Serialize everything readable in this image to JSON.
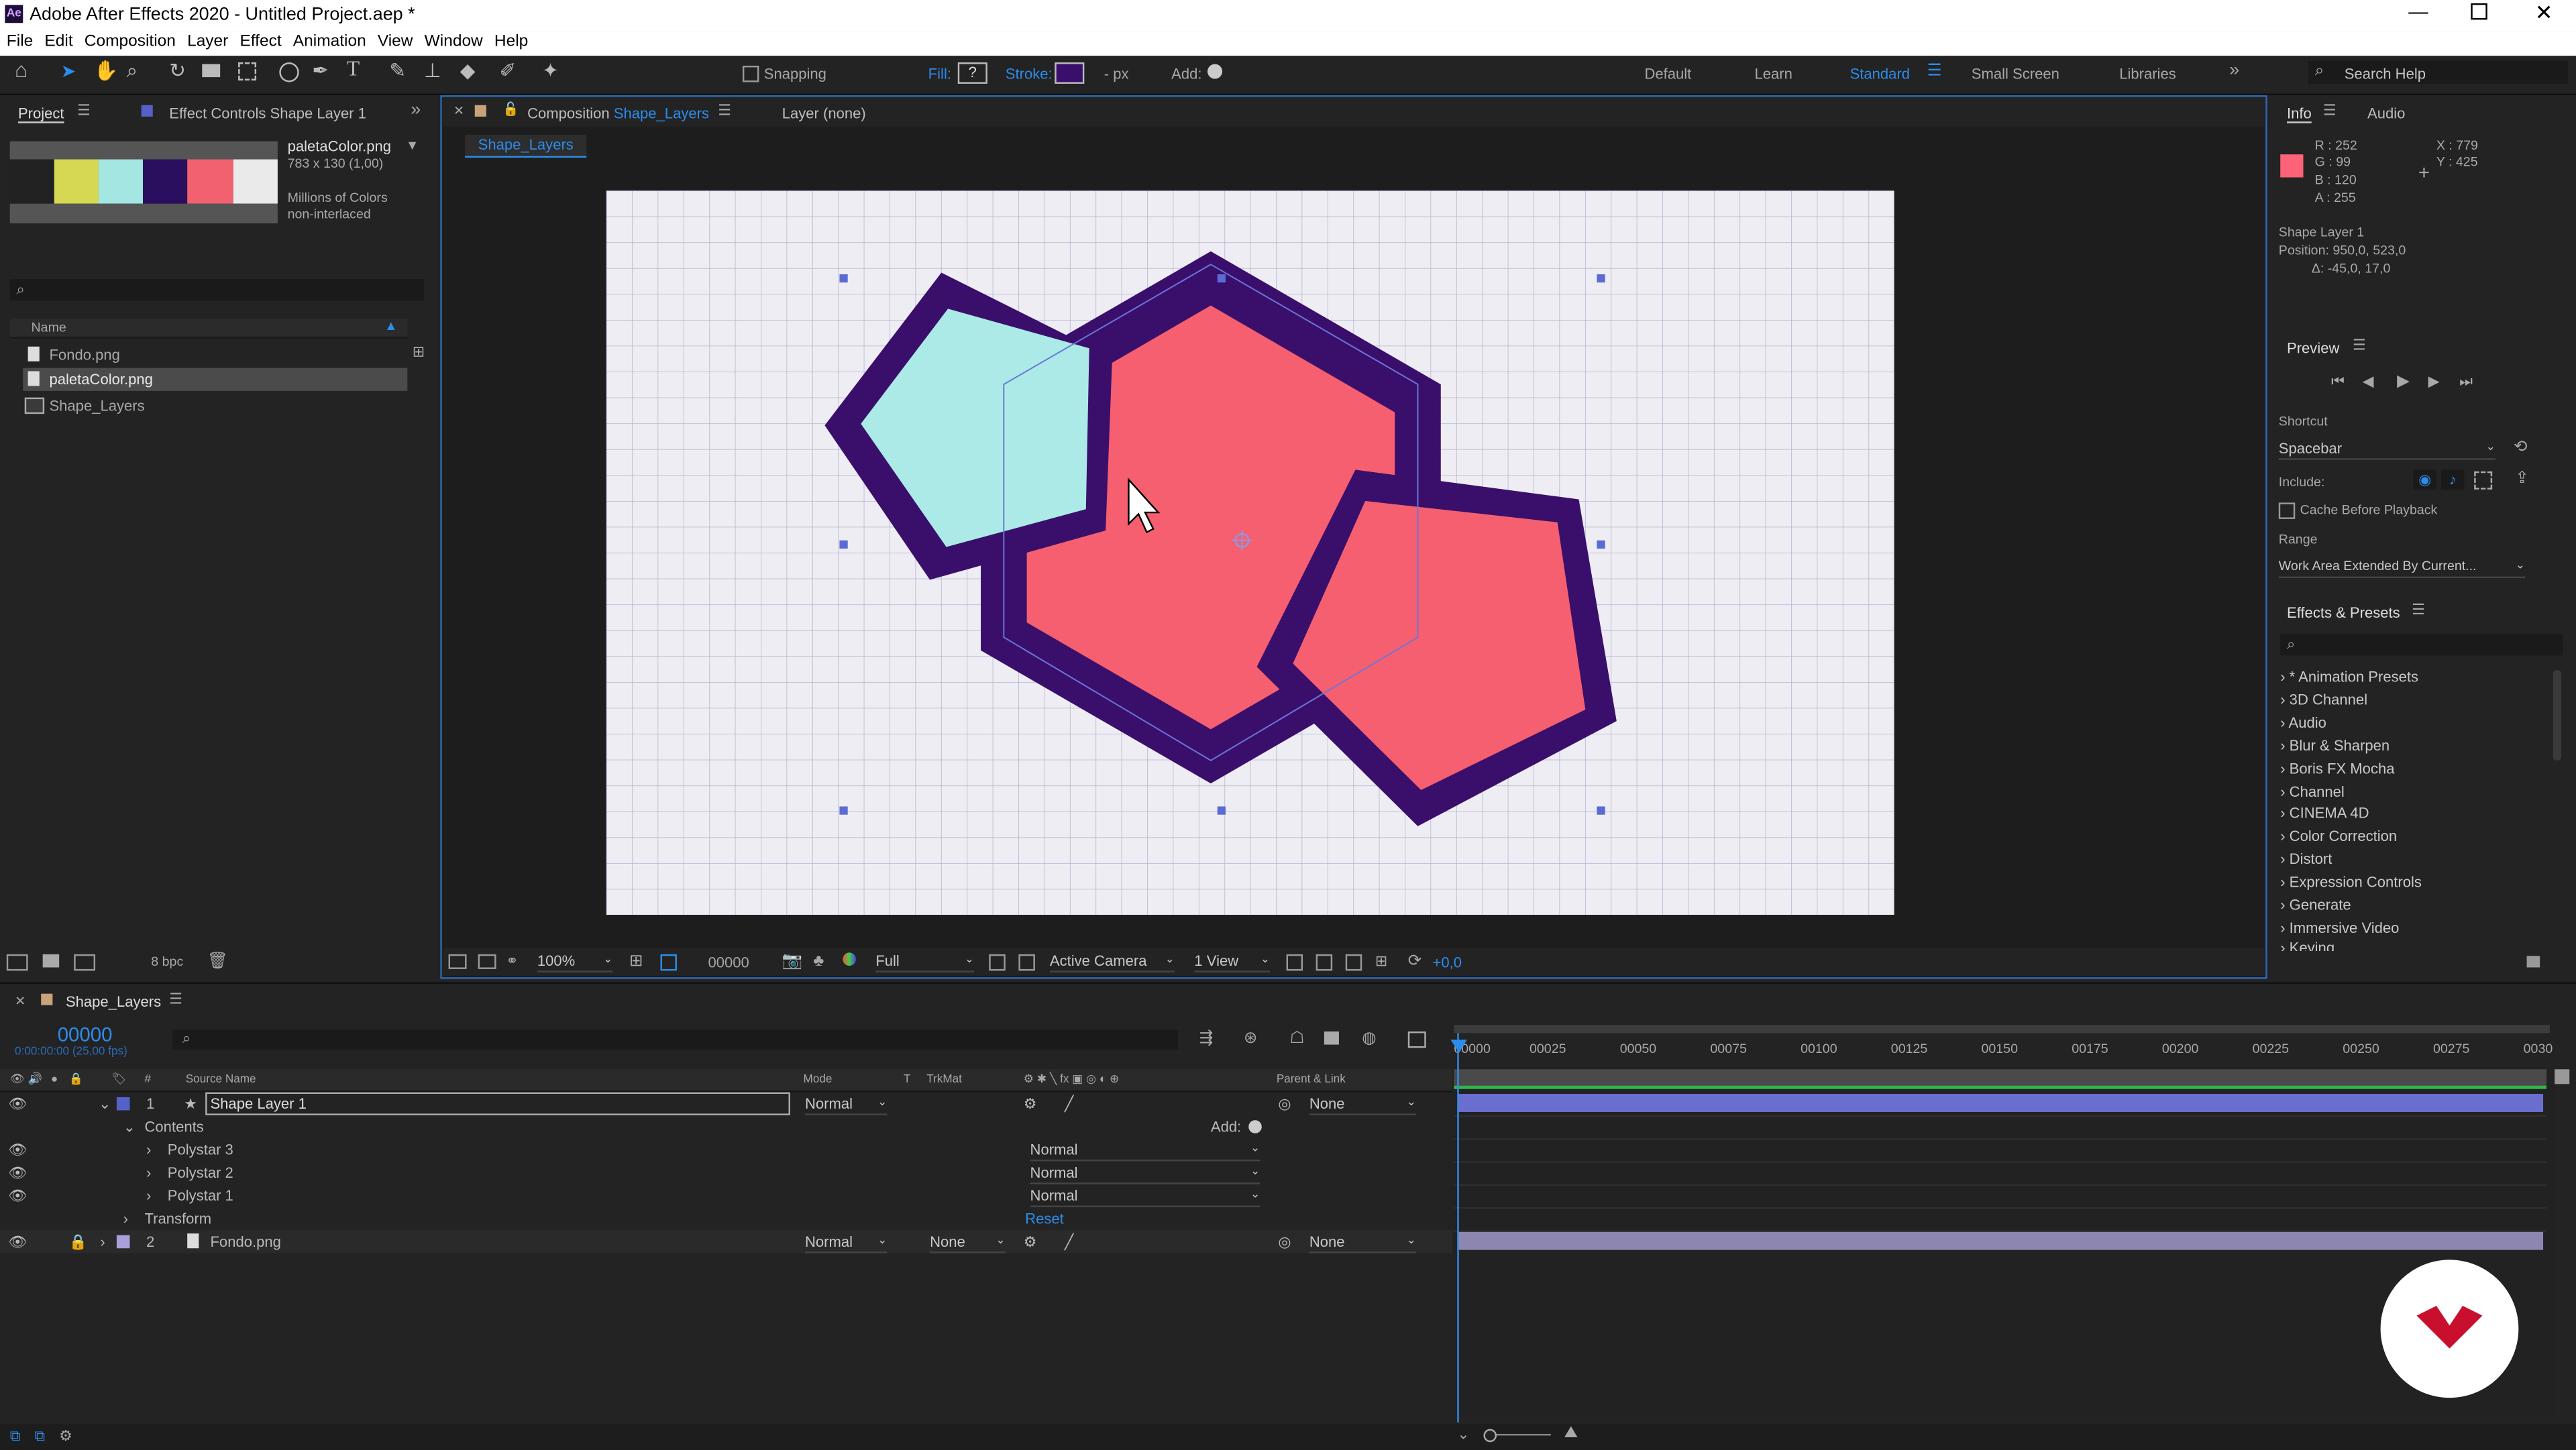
{
  "app": {
    "title": "Adobe After Effects 2020 - Untitled Project.aep *",
    "menu": [
      "File",
      "Edit",
      "Composition",
      "Layer",
      "Effect",
      "Animation",
      "View",
      "Window",
      "Help"
    ]
  },
  "toolbar": {
    "snapping": "Snapping",
    "fill_label": "Fill:",
    "fill_value": "?",
    "stroke_label": "Stroke:",
    "stroke_unit": "- px",
    "add_label": "Add:",
    "workspaces": [
      "Default",
      "Learn",
      "Standard",
      "Small Screen",
      "Libraries"
    ],
    "active_workspace": "Standard",
    "search_placeholder": "Search Help"
  },
  "project": {
    "tab_project": "Project",
    "tab_effect": "Effect Controls Shape Layer 1",
    "thumb_name": "paletaColor.png",
    "thumb_size": "783 x 130 (1,00)",
    "thumb_colors": "Millions of Colors",
    "thumb_interlace": "non-interlaced",
    "column_name": "Name",
    "items": [
      "Fondo.png",
      "paletaColor.png",
      "Shape_Layers"
    ],
    "bpc": "8 bpc",
    "palette": [
      "#222222",
      "#d6d854",
      "#a4e6e2",
      "#2a0f5e",
      "#f26170",
      "#eaeaea"
    ]
  },
  "composition": {
    "tab_prefix": "Composition",
    "tab_name": "Shape_Layers",
    "layer_tab": "Layer (none)",
    "sub_tab": "Shape_Layers",
    "zoom": "100%",
    "timecode": "00000",
    "resolution": "Full",
    "camera": "Active Camera",
    "views": "1 View",
    "exposure": "+0,0"
  },
  "info": {
    "tab_info": "Info",
    "tab_audio": "Audio",
    "r": "R : 252",
    "g": "G : 99",
    "b": "B : 120",
    "a": "A : 255",
    "x": "X : 779",
    "y": "Y : 425",
    "layer": "Shape Layer 1",
    "position": "Position: 950,0, 523,0",
    "delta": "Δ: -45,0, 17,0",
    "sample_color": "#fc6378"
  },
  "preview": {
    "title": "Preview",
    "shortcut_label": "Shortcut",
    "shortcut_value": "Spacebar",
    "include_label": "Include:",
    "cache": "Cache Before Playback",
    "range_label": "Range",
    "range_value": "Work Area Extended By Current..."
  },
  "effects": {
    "title": "Effects & Presets",
    "items": [
      "* Animation Presets",
      "3D Channel",
      "Audio",
      "Blur & Sharpen",
      "Boris FX Mocha",
      "Channel",
      "CINEMA 4D",
      "Color Correction",
      "Distort",
      "Expression Controls",
      "Generate",
      "Immersive Video",
      "Keying"
    ]
  },
  "timeline": {
    "tab": "Shape_Layers",
    "timecode": "00000",
    "timecode_sub": "0:00:00:00 (25,00 fps)",
    "headers": {
      "source": "Source Name",
      "mode": "Mode",
      "t": "T",
      "trkmat": "TrkMat",
      "parent": "Parent & Link"
    },
    "ruler": [
      "00000",
      "00025",
      "00050",
      "00075",
      "00100",
      "00125",
      "00150",
      "00175",
      "00200",
      "00225",
      "00250",
      "00275",
      "0030"
    ],
    "layer1": {
      "num": "1",
      "name": "Shape Layer 1",
      "mode": "Normal",
      "parent": "None"
    },
    "contents": "Contents",
    "add": "Add:",
    "polystars": [
      {
        "name": "Polystar 3",
        "mode": "Normal"
      },
      {
        "name": "Polystar 2",
        "mode": "Normal"
      },
      {
        "name": "Polystar 1",
        "mode": "Normal"
      }
    ],
    "transform": "Transform",
    "reset": "Reset",
    "layer2": {
      "num": "2",
      "name": "Fondo.png",
      "mode": "Normal",
      "trkmat": "None",
      "parent": "None"
    }
  },
  "colors": {
    "accent": "#2d8ceb",
    "coral": "#f65f6f",
    "cyan": "#abeae6",
    "purple": "#3a0f6b",
    "layer_bar": "#6a6fcf",
    "layer2_bar": "#8c86b0"
  }
}
